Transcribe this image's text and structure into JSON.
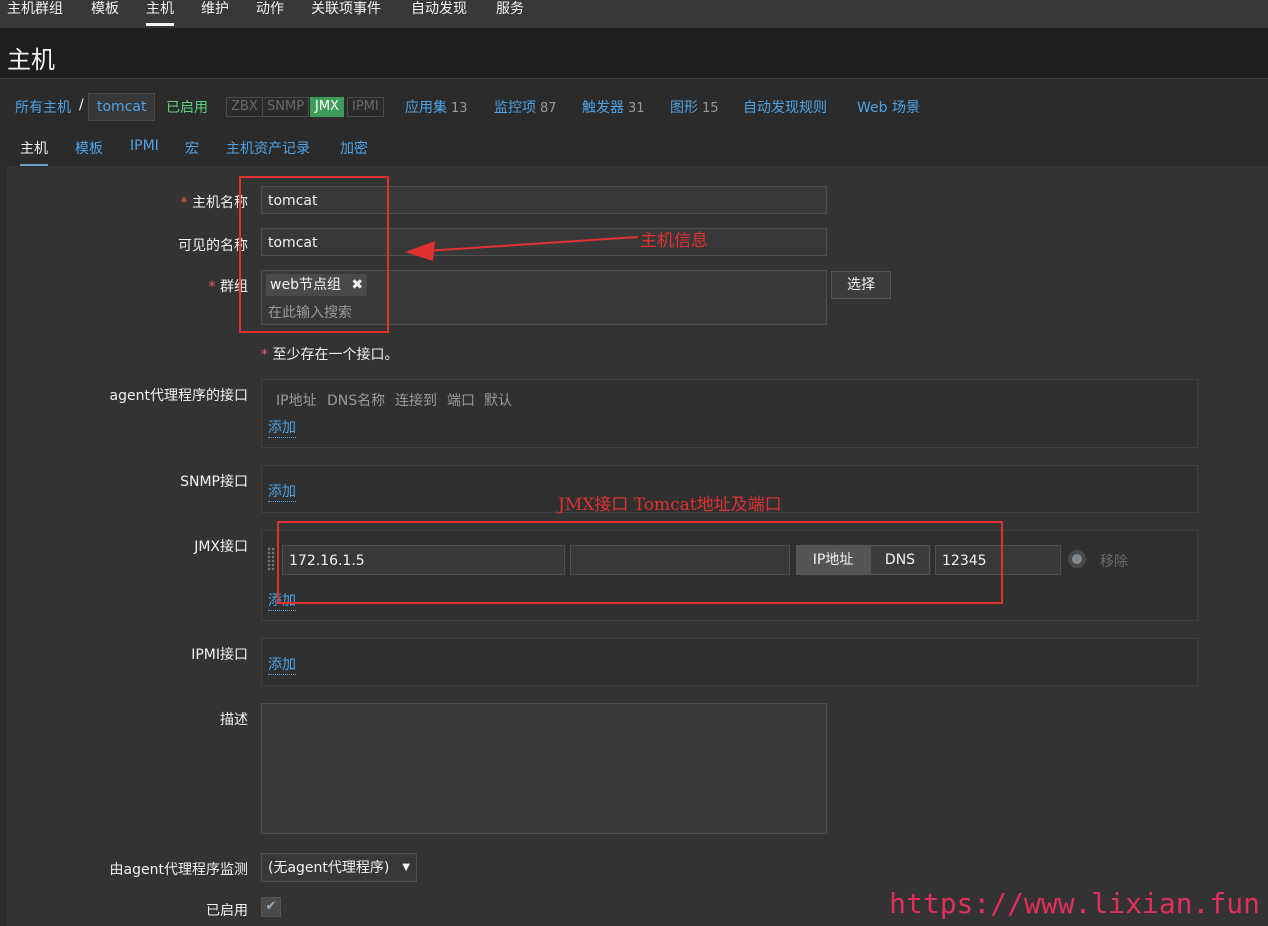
{
  "nav": [
    "主机群组",
    "模板",
    "主机",
    "维护",
    "动作",
    "关联项事件",
    "自动发现",
    "服务"
  ],
  "header": {
    "title": "主机"
  },
  "breadcrumb": {
    "all_hosts": "所有主机",
    "separator": "/",
    "host": "tomcat",
    "status": "已启用",
    "tags": [
      "ZBX",
      "SNMP",
      "JMX",
      "IPMI"
    ],
    "links": [
      {
        "label": "应用集",
        "count": "13"
      },
      {
        "label": "监控项",
        "count": "87"
      },
      {
        "label": "触发器",
        "count": "31"
      },
      {
        "label": "图形",
        "count": "15"
      },
      {
        "label": "自动发现规则",
        "count": ""
      },
      {
        "label": "Web 场景",
        "count": ""
      }
    ]
  },
  "tabs": [
    "主机",
    "模板",
    "IPMI",
    "宏",
    "主机资产记录",
    "加密"
  ],
  "form": {
    "host_name_label": "主机名称",
    "host_name": "tomcat",
    "visible_name_label": "可见的名称",
    "visible_name": "tomcat",
    "groups_label": "群组",
    "group_tag": "web节点组",
    "group_remove": "✖",
    "group_placeholder": "在此输入搜索",
    "select_button": "选择",
    "required_note": "至少存在一个接口。",
    "agent_label": "agent代理程序的接口",
    "agent_headers": [
      "IP地址",
      "DNS名称",
      "连接到",
      "端口",
      "默认"
    ],
    "add": "添加",
    "snmp_label": "SNMP接口",
    "jmx_label": "JMX接口",
    "jmx_ip": "172.16.1.5",
    "jmx_dns": "",
    "connect_ip": "IP地址",
    "connect_dns": "DNS",
    "jmx_port": "12345",
    "remove": "移除",
    "ipmi_label": "IPMI接口",
    "description_label": "描述",
    "proxy_label": "由agent代理程序监测",
    "proxy_value": "(无agent代理程序)",
    "enabled_label": "已启用"
  },
  "annotations": {
    "host_info": "主机信息",
    "jmx_info": "JMX接口 Tomcat地址及端口"
  },
  "watermark": "https://www.lixian.fun"
}
